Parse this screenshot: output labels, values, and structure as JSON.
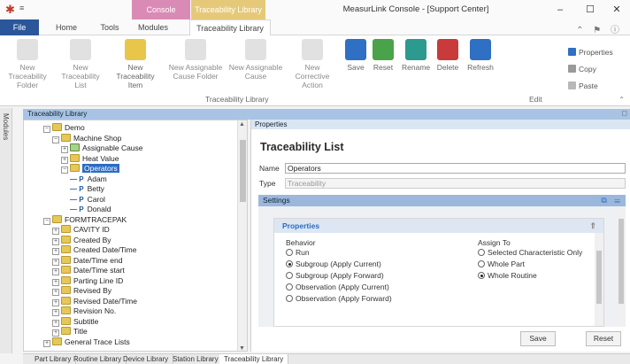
{
  "titlebar": {
    "window_title": "MeasurLink Console - [Support Center]",
    "context_tabs": [
      "Console",
      "Traceability Library"
    ]
  },
  "ribbon_tabs": [
    "File",
    "Home",
    "Tools",
    "Modules",
    "Traceability Library"
  ],
  "ribbon": {
    "buttons": {
      "new_trace_folder": "New Traceability Folder",
      "new_list": "New Traceability List",
      "new_item": "New Traceability Item",
      "new_assign_folder": "New Assignable Cause Folder",
      "new_assign_cause": "New Assignable Cause",
      "new_corrective": "New Corrective Action",
      "save": "Save",
      "reset": "Reset",
      "rename": "Rename",
      "delete": "Delete",
      "refresh": "Refresh",
      "properties": "Properties",
      "copy": "Copy",
      "paste": "Paste"
    },
    "groups": {
      "traceability_library": "Traceability Library",
      "edit": "Edit"
    }
  },
  "modules_strip": "Modules",
  "tree": {
    "header": "Traceability Library",
    "rows": [
      {
        "label": "Demo",
        "indent": 1,
        "kind": "folder",
        "exp": "−"
      },
      {
        "label": "Machine Shop",
        "indent": 2,
        "kind": "folder",
        "exp": "−"
      },
      {
        "label": "Assignable Cause",
        "indent": 3,
        "kind": "folder-green",
        "exp": "+"
      },
      {
        "label": "Heat Value",
        "indent": 3,
        "kind": "list",
        "exp": "+"
      },
      {
        "label": "Operators",
        "indent": 3,
        "kind": "list",
        "exp": "−",
        "selected": true
      },
      {
        "label": "Adam",
        "indent": 4,
        "kind": "item"
      },
      {
        "label": "Betty",
        "indent": 4,
        "kind": "item"
      },
      {
        "label": "Carol",
        "indent": 4,
        "kind": "item"
      },
      {
        "label": "Donald",
        "indent": 4,
        "kind": "item"
      },
      {
        "label": "FORMTRACEPAK",
        "indent": 1,
        "kind": "folder",
        "exp": "−"
      },
      {
        "label": "CAVITY ID",
        "indent": 2,
        "kind": "list",
        "exp": "+"
      },
      {
        "label": "Created By",
        "indent": 2,
        "kind": "list",
        "exp": "+"
      },
      {
        "label": "Created Date/Time",
        "indent": 2,
        "kind": "list",
        "exp": "+"
      },
      {
        "label": "Date/Time end",
        "indent": 2,
        "kind": "list",
        "exp": "+"
      },
      {
        "label": "Date/Time start",
        "indent": 2,
        "kind": "list",
        "exp": "+"
      },
      {
        "label": "Parting Line ID",
        "indent": 2,
        "kind": "list",
        "exp": "+"
      },
      {
        "label": "Revised By",
        "indent": 2,
        "kind": "list",
        "exp": "+"
      },
      {
        "label": "Revised Date/Time",
        "indent": 2,
        "kind": "list",
        "exp": "+"
      },
      {
        "label": "Revision No.",
        "indent": 2,
        "kind": "list",
        "exp": "+"
      },
      {
        "label": "Subtitle",
        "indent": 2,
        "kind": "list",
        "exp": "+"
      },
      {
        "label": "Title",
        "indent": 2,
        "kind": "list",
        "exp": "+"
      },
      {
        "label": "General Trace Lists",
        "indent": 1,
        "kind": "folder",
        "exp": "+"
      }
    ]
  },
  "properties": {
    "tab_header": "Properties",
    "title": "Traceability List",
    "name_label": "Name",
    "name_value": "Operators",
    "type_label": "Type",
    "type_value": "Traceability",
    "settings_label": "Settings",
    "card_title": "Properties",
    "behavior_label": "Behavior",
    "behavior_options": [
      {
        "label": "Run",
        "checked": false
      },
      {
        "label": "Subgroup (Apply Current)",
        "checked": true
      },
      {
        "label": "Subgroup (Apply Forward)",
        "checked": false
      },
      {
        "label": "Observation (Apply Current)",
        "checked": false
      },
      {
        "label": "Observation (Apply Forward)",
        "checked": false
      }
    ],
    "assign_label": "Assign To",
    "assign_options": [
      {
        "label": "Selected Characteristic Only",
        "checked": false
      },
      {
        "label": "Whole Part",
        "checked": false
      },
      {
        "label": "Whole Routine",
        "checked": true
      }
    ],
    "save_button": "Save",
    "reset_button": "Reset"
  },
  "bottom_tabs": [
    "Part Library",
    "Routine Library",
    "Device Library",
    "Station Library",
    "Traceability Library"
  ],
  "active_bottom_tab": "Traceability Library"
}
